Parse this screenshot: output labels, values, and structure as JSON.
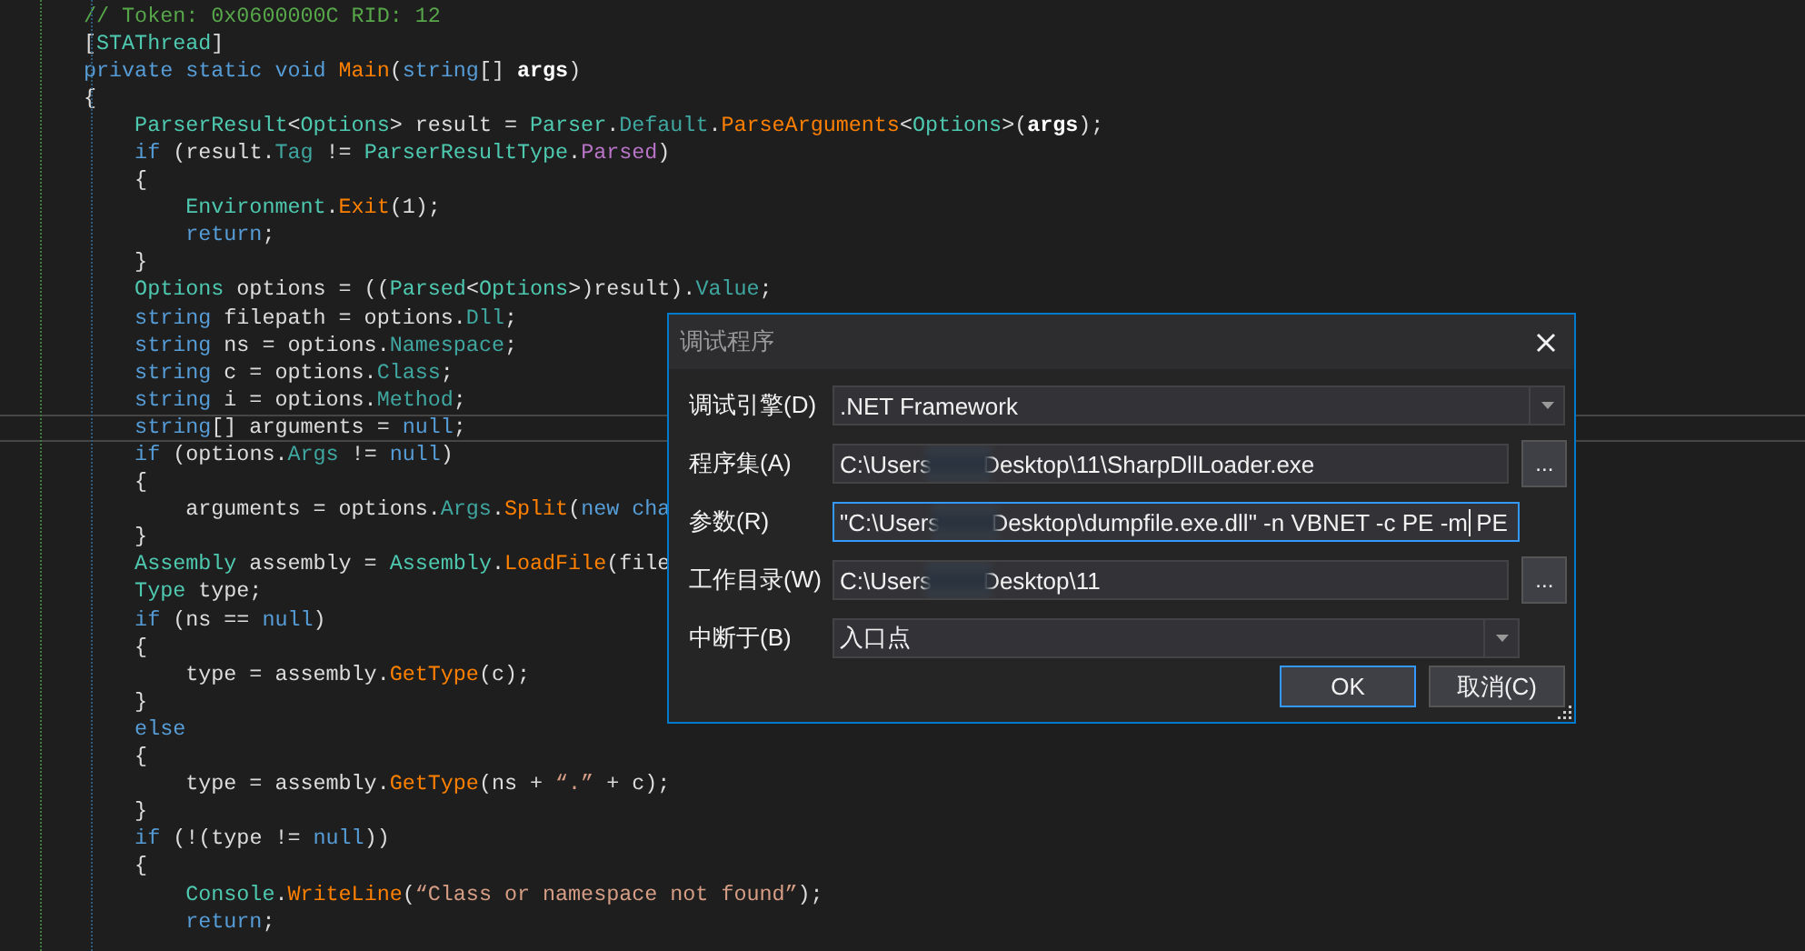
{
  "code": {
    "lines": [
      [
        {
          "kind": "comment",
          "text": "// Token: 0x0600000C RID: 12"
        }
      ],
      [
        {
          "kind": "plain",
          "text": "["
        },
        {
          "kind": "type",
          "text": "STAThread"
        },
        {
          "kind": "plain",
          "text": "]"
        }
      ],
      [
        {
          "kind": "keyword",
          "text": "private static void "
        },
        {
          "kind": "method",
          "text": "Main"
        },
        {
          "kind": "plain",
          "text": "("
        },
        {
          "kind": "keyword",
          "text": "string"
        },
        {
          "kind": "plain",
          "text": "[] "
        },
        {
          "kind": "param",
          "text": "args"
        },
        {
          "kind": "plain",
          "text": ")"
        }
      ],
      [
        {
          "kind": "plain",
          "text": "{"
        }
      ],
      [
        {
          "kind": "type",
          "text": "    ParserResult"
        },
        {
          "kind": "plain",
          "text": "<"
        },
        {
          "kind": "type",
          "text": "Options"
        },
        {
          "kind": "plain",
          "text": "> result = "
        },
        {
          "kind": "type",
          "text": "Parser"
        },
        {
          "kind": "plain",
          "text": "."
        },
        {
          "kind": "property",
          "text": "Default"
        },
        {
          "kind": "plain",
          "text": "."
        },
        {
          "kind": "method",
          "text": "ParseArguments"
        },
        {
          "kind": "plain",
          "text": "<"
        },
        {
          "kind": "type",
          "text": "Options"
        },
        {
          "kind": "plain",
          "text": ">("
        },
        {
          "kind": "param",
          "text": "args"
        },
        {
          "kind": "plain",
          "text": ");"
        }
      ],
      [
        {
          "kind": "keyword",
          "text": "    if"
        },
        {
          "kind": "plain",
          "text": " (result."
        },
        {
          "kind": "property",
          "text": "Tag"
        },
        {
          "kind": "plain",
          "text": " != "
        },
        {
          "kind": "type",
          "text": "ParserResultType"
        },
        {
          "kind": "plain",
          "text": "."
        },
        {
          "kind": "enum",
          "text": "Parsed"
        },
        {
          "kind": "plain",
          "text": ")"
        }
      ],
      [
        {
          "kind": "plain",
          "text": "    {"
        }
      ],
      [
        {
          "kind": "type",
          "text": "        Environment"
        },
        {
          "kind": "plain",
          "text": "."
        },
        {
          "kind": "method",
          "text": "Exit"
        },
        {
          "kind": "plain",
          "text": "(1);"
        }
      ],
      [
        {
          "kind": "keyword",
          "text": "        return"
        },
        {
          "kind": "plain",
          "text": ";"
        }
      ],
      [
        {
          "kind": "plain",
          "text": "    }"
        }
      ],
      [
        {
          "kind": "type",
          "text": "    Options"
        },
        {
          "kind": "plain",
          "text": " options = (("
        },
        {
          "kind": "type",
          "text": "Parsed"
        },
        {
          "kind": "plain",
          "text": "<"
        },
        {
          "kind": "type",
          "text": "Options"
        },
        {
          "kind": "plain",
          "text": ">)result)."
        },
        {
          "kind": "property",
          "text": "Value"
        },
        {
          "kind": "plain",
          "text": ";"
        }
      ],
      [
        {
          "kind": "keyword",
          "text": "    string"
        },
        {
          "kind": "plain",
          "text": " filepath = options."
        },
        {
          "kind": "property",
          "text": "Dll"
        },
        {
          "kind": "plain",
          "text": ";"
        }
      ],
      [
        {
          "kind": "keyword",
          "text": "    string"
        },
        {
          "kind": "plain",
          "text": " ns = options."
        },
        {
          "kind": "property",
          "text": "Namespace"
        },
        {
          "kind": "plain",
          "text": ";"
        }
      ],
      [
        {
          "kind": "keyword",
          "text": "    string"
        },
        {
          "kind": "plain",
          "text": " c = options."
        },
        {
          "kind": "property",
          "text": "Class"
        },
        {
          "kind": "plain",
          "text": ";"
        }
      ],
      [
        {
          "kind": "keyword",
          "text": "    string"
        },
        {
          "kind": "plain",
          "text": " i = options."
        },
        {
          "kind": "property",
          "text": "Method"
        },
        {
          "kind": "plain",
          "text": ";"
        }
      ],
      [
        {
          "kind": "keyword",
          "text": "    string"
        },
        {
          "kind": "plain",
          "text": "[] arguments = "
        },
        {
          "kind": "keyword",
          "text": "null"
        },
        {
          "kind": "plain",
          "text": ";"
        }
      ],
      [
        {
          "kind": "keyword",
          "text": "    if"
        },
        {
          "kind": "plain",
          "text": " (options."
        },
        {
          "kind": "property",
          "text": "Args"
        },
        {
          "kind": "plain",
          "text": " != "
        },
        {
          "kind": "keyword",
          "text": "null"
        },
        {
          "kind": "plain",
          "text": ")"
        }
      ],
      [
        {
          "kind": "plain",
          "text": "    {"
        }
      ],
      [
        {
          "kind": "plain",
          "text": "        arguments = options."
        },
        {
          "kind": "property",
          "text": "Args"
        },
        {
          "kind": "plain",
          "text": "."
        },
        {
          "kind": "method",
          "text": "Split"
        },
        {
          "kind": "plain",
          "text": "("
        },
        {
          "kind": "keyword",
          "text": "new cha"
        }
      ],
      [
        {
          "kind": "plain",
          "text": "    }"
        }
      ],
      [
        {
          "kind": "type",
          "text": "    Assembly"
        },
        {
          "kind": "plain",
          "text": " assembly = "
        },
        {
          "kind": "type",
          "text": "Assembly"
        },
        {
          "kind": "plain",
          "text": "."
        },
        {
          "kind": "method",
          "text": "LoadFile"
        },
        {
          "kind": "plain",
          "text": "(file"
        }
      ],
      [
        {
          "kind": "type",
          "text": "    Type"
        },
        {
          "kind": "plain",
          "text": " type;"
        }
      ],
      [
        {
          "kind": "keyword",
          "text": "    if"
        },
        {
          "kind": "plain",
          "text": " (ns == "
        },
        {
          "kind": "keyword",
          "text": "null"
        },
        {
          "kind": "plain",
          "text": ")"
        }
      ],
      [
        {
          "kind": "plain",
          "text": "    {"
        }
      ],
      [
        {
          "kind": "plain",
          "text": "        type = assembly."
        },
        {
          "kind": "method",
          "text": "GetType"
        },
        {
          "kind": "plain",
          "text": "(c);"
        }
      ],
      [
        {
          "kind": "plain",
          "text": "    }"
        }
      ],
      [
        {
          "kind": "keyword",
          "text": "    else"
        }
      ],
      [
        {
          "kind": "plain",
          "text": "    {"
        }
      ],
      [
        {
          "kind": "plain",
          "text": "        type = assembly."
        },
        {
          "kind": "method",
          "text": "GetType"
        },
        {
          "kind": "plain",
          "text": "(ns + "
        },
        {
          "kind": "string",
          "text": "“.”"
        },
        {
          "kind": "plain",
          "text": " + c);"
        }
      ],
      [
        {
          "kind": "plain",
          "text": "    }"
        }
      ],
      [
        {
          "kind": "keyword",
          "text": "    if"
        },
        {
          "kind": "plain",
          "text": " (!(type != "
        },
        {
          "kind": "keyword",
          "text": "null"
        },
        {
          "kind": "plain",
          "text": "))"
        }
      ],
      [
        {
          "kind": "plain",
          "text": "    {"
        }
      ],
      [
        {
          "kind": "type",
          "text": "        Console"
        },
        {
          "kind": "plain",
          "text": "."
        },
        {
          "kind": "method",
          "text": "WriteLine"
        },
        {
          "kind": "plain",
          "text": "("
        },
        {
          "kind": "string",
          "text": "“Class or namespace not found”"
        },
        {
          "kind": "plain",
          "text": ");"
        }
      ],
      [
        {
          "kind": "keyword",
          "text": "        return"
        },
        {
          "kind": "plain",
          "text": ";"
        }
      ]
    ]
  },
  "dialog": {
    "title": "调试程序",
    "fields": [
      {
        "label": "调试引擎(D)",
        "kind": "combo",
        "value": ".NET Framework",
        "focused": false
      },
      {
        "label": "程序集(A)",
        "kind": "path",
        "value_start": "C:\\Users",
        "value_end": "Desktop\\11\\SharpDllLoader.exe",
        "browse": "...",
        "focused": false
      },
      {
        "label": "参数(R)",
        "kind": "path",
        "value_start": "\"C:\\Users",
        "value_end": "Desktop\\dumpfile.exe.dll\" -n VBNET -c PE -m",
        "value_tail": " PE",
        "focused": true
      },
      {
        "label": "工作目录(W)",
        "kind": "path",
        "value_start": "C:\\Users",
        "value_end": "Desktop\\11",
        "browse": "...",
        "focused": false
      },
      {
        "label": "中断于(B)",
        "kind": "combo",
        "value": "入口点",
        "focused": false
      }
    ],
    "buttons": [
      {
        "label": "OK",
        "default": true
      },
      {
        "label": "取消(C)",
        "default": false
      }
    ]
  }
}
